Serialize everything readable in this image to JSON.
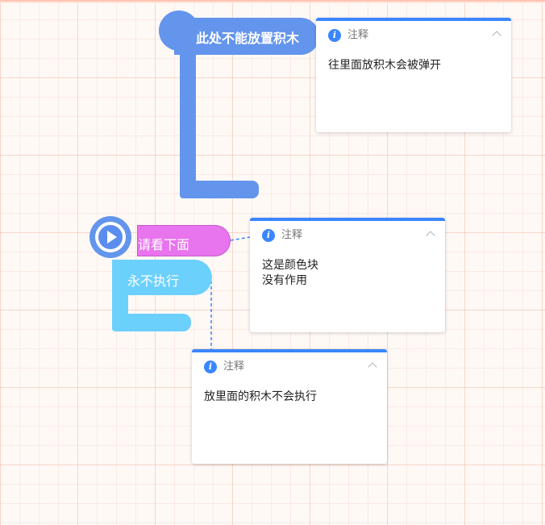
{
  "canvas": {
    "background": "#fff9f6",
    "grid_color": "#f6d8cc"
  },
  "blocks": {
    "hat_block": {
      "label": "此处不能放置积木",
      "color": "#6495ed"
    },
    "start_button": {
      "icon": "play-icon",
      "color": "#5b8def"
    },
    "color_block": {
      "label": "请看下面",
      "color": "#e874ee"
    },
    "never_block": {
      "label": "永不执行",
      "color": "#6cd0fd"
    }
  },
  "comments": [
    {
      "title": "注释",
      "lines": [
        "往里面放积木会被弹开"
      ],
      "accent": "#3a86ff"
    },
    {
      "title": "注释",
      "lines": [
        "这是颜色块",
        "没有作用"
      ],
      "accent": "#3a86ff"
    },
    {
      "title": "注释",
      "lines": [
        "放里面的积木不会执行"
      ],
      "accent": "#3a86ff"
    }
  ]
}
